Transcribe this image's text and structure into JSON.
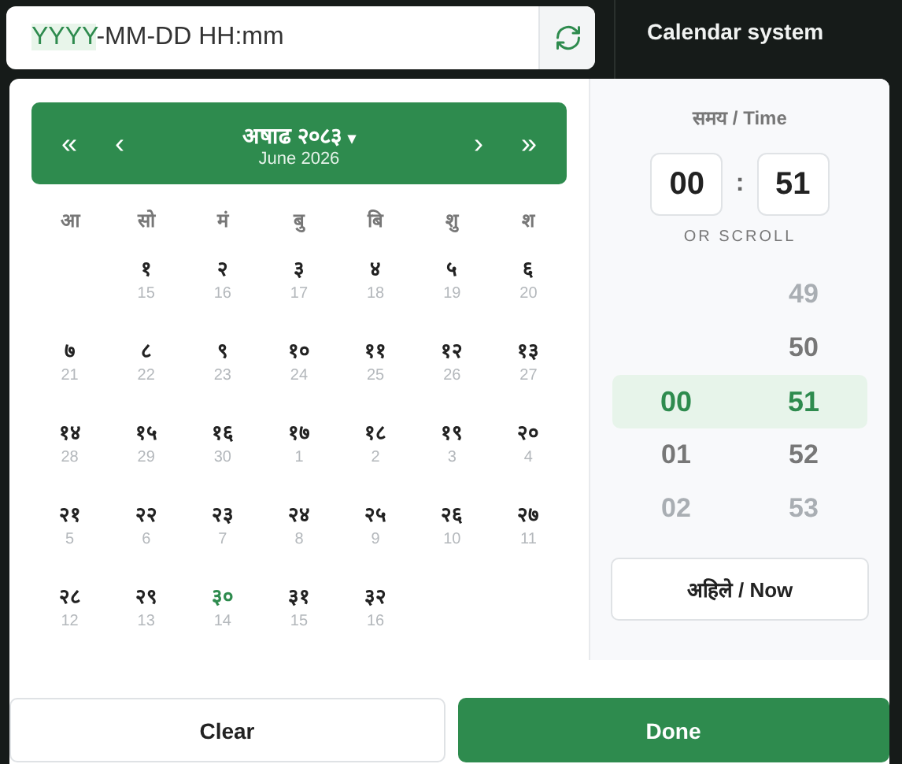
{
  "input": {
    "highlight": "YYYY",
    "rest": "-MM-DD HH:mm"
  },
  "side_title": "Calendar system",
  "header": {
    "month": "अषाढ २०८३",
    "caret": "▾",
    "sub": "June 2026",
    "first": "«",
    "prev": "‹",
    "next": "›",
    "last": "»"
  },
  "weekdays": [
    "आ",
    "सो",
    "मं",
    "बु",
    "बि",
    "शु",
    "श"
  ],
  "weeks": [
    [
      {
        "kind": "blank"
      },
      {
        "kind": "day",
        "np": "१",
        "en": "15",
        "today": false
      },
      {
        "kind": "day",
        "np": "२",
        "en": "16",
        "today": false
      },
      {
        "kind": "day",
        "np": "३",
        "en": "17",
        "today": false
      },
      {
        "kind": "day",
        "np": "४",
        "en": "18",
        "today": false
      },
      {
        "kind": "day",
        "np": "५",
        "en": "19",
        "today": false
      },
      {
        "kind": "day",
        "np": "६",
        "en": "20",
        "today": false
      }
    ],
    [
      {
        "kind": "day",
        "np": "७",
        "en": "21",
        "today": false
      },
      {
        "kind": "day",
        "np": "८",
        "en": "22",
        "today": false
      },
      {
        "kind": "day",
        "np": "९",
        "en": "23",
        "today": false
      },
      {
        "kind": "day",
        "np": "१०",
        "en": "24",
        "today": false
      },
      {
        "kind": "day",
        "np": "११",
        "en": "25",
        "today": false
      },
      {
        "kind": "day",
        "np": "१२",
        "en": "26",
        "today": false
      },
      {
        "kind": "day",
        "np": "१३",
        "en": "27",
        "today": false
      }
    ],
    [
      {
        "kind": "day",
        "np": "१४",
        "en": "28",
        "today": false
      },
      {
        "kind": "day",
        "np": "१५",
        "en": "29",
        "today": false
      },
      {
        "kind": "day",
        "np": "१६",
        "en": "30",
        "today": false
      },
      {
        "kind": "day",
        "np": "१७",
        "en": "1",
        "today": false
      },
      {
        "kind": "day",
        "np": "१८",
        "en": "2",
        "today": false
      },
      {
        "kind": "day",
        "np": "१९",
        "en": "3",
        "today": false
      },
      {
        "kind": "day",
        "np": "२०",
        "en": "4",
        "today": false
      }
    ],
    [
      {
        "kind": "day",
        "np": "२१",
        "en": "5",
        "today": false
      },
      {
        "kind": "day",
        "np": "२२",
        "en": "6",
        "today": false
      },
      {
        "kind": "day",
        "np": "२३",
        "en": "7",
        "today": false
      },
      {
        "kind": "day",
        "np": "२४",
        "en": "8",
        "today": false
      },
      {
        "kind": "day",
        "np": "२५",
        "en": "9",
        "today": false
      },
      {
        "kind": "day",
        "np": "२६",
        "en": "10",
        "today": false
      },
      {
        "kind": "day",
        "np": "२७",
        "en": "11",
        "today": false
      }
    ],
    [
      {
        "kind": "day",
        "np": "२८",
        "en": "12",
        "today": false
      },
      {
        "kind": "day",
        "np": "२९",
        "en": "13",
        "today": false
      },
      {
        "kind": "day",
        "np": "३०",
        "en": "14",
        "today": true
      },
      {
        "kind": "day",
        "np": "३१",
        "en": "15",
        "today": false
      },
      {
        "kind": "day",
        "np": "३२",
        "en": "16",
        "today": false
      }
    ]
  ],
  "time": {
    "title": "समय / Time",
    "hour": "00",
    "sep": ":",
    "minute": "51",
    "hint": "OR SCROLL",
    "wheel": [
      {
        "minute": "49",
        "selected": false,
        "faded": true
      },
      {
        "minute": "50",
        "selected": false,
        "faded": false
      },
      {
        "hour": "00",
        "minute": "51",
        "selected": true,
        "faded": false
      },
      {
        "hour": "01",
        "minute": "52",
        "selected": false,
        "faded": false
      },
      {
        "hour": "02",
        "minute": "53",
        "selected": false,
        "faded": true
      }
    ],
    "now": "अहिले / Now"
  },
  "buttons": {
    "clear": "Clear",
    "done": "Done"
  }
}
